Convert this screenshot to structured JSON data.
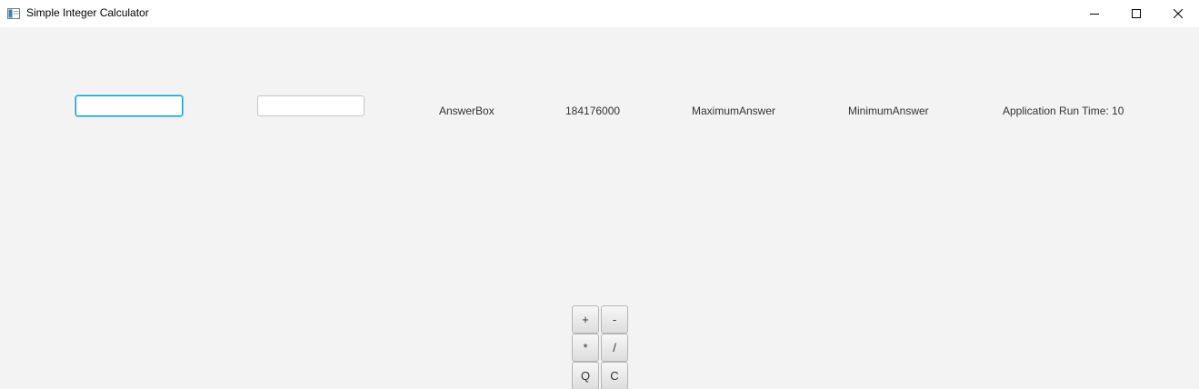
{
  "window": {
    "title": "Simple Integer Calculator",
    "controls": {
      "minimize_icon": "minimize-icon",
      "maximize_icon": "maximize-icon",
      "close_icon": "close-icon"
    }
  },
  "inputs": {
    "first_operand": {
      "value": "",
      "placeholder": ""
    },
    "second_operand": {
      "value": "",
      "placeholder": ""
    }
  },
  "labels": {
    "answer_box": "AnswerBox",
    "current_value": "184176000",
    "maximum_answer": "MaximumAnswer",
    "minimum_answer": "MinimumAnswer",
    "run_time": "Application Run Time: 10"
  },
  "keypad": {
    "add": "+",
    "subtract": "-",
    "multiply": "*",
    "divide": "/",
    "quit": "Q",
    "clear": "C"
  },
  "colors": {
    "content_background": "#f3f3f3",
    "focus_accent": "#039ed3"
  }
}
